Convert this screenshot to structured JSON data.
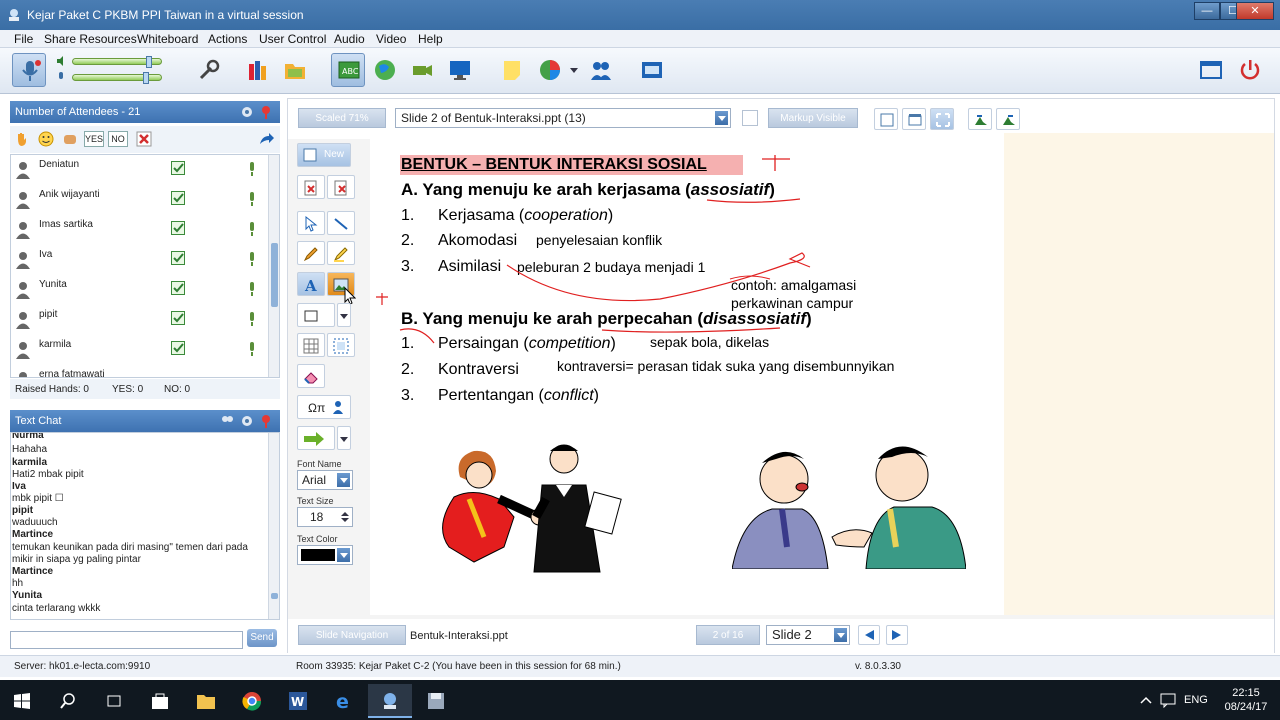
{
  "window": {
    "title": "Kejar Paket C PKBM PPI Taiwan in a virtual session",
    "controls": [
      "minimize",
      "maximize",
      "close"
    ]
  },
  "menu": [
    "File",
    "Share Resources",
    "Whiteboard",
    "Actions",
    "User Control",
    "Audio",
    "Video",
    "Help"
  ],
  "audio": {
    "mic_level": 0.92,
    "speaker_level": 0.88
  },
  "attendees": {
    "header": "Number of Attendees - 21",
    "quick_buttons": {
      "yes": "YES",
      "no": "NO"
    },
    "list": [
      {
        "name": "Deniatun"
      },
      {
        "name": "Anik wijayanti"
      },
      {
        "name": "Imas sartika"
      },
      {
        "name": "Iva"
      },
      {
        "name": "Yunita"
      },
      {
        "name": "pipit"
      },
      {
        "name": "karmila"
      },
      {
        "name": "erna fatmawati"
      }
    ],
    "raised_hands": "Raised Hands: 0",
    "yes_count": "YES: 0",
    "no_count": "NO: 0"
  },
  "chat": {
    "header": "Text Chat",
    "messages": [
      {
        "user": "Nurma",
        "text": "Hahaha"
      },
      {
        "user": "karmila",
        "text": "Hati2 mbak pipit"
      },
      {
        "user": "Iva",
        "text": "mbk pipit ☐"
      },
      {
        "user": "pipit",
        "text": "waduuuch"
      },
      {
        "user": "Martince",
        "text": "temukan keunikan pada diri masing\" temen dari pada",
        "text2": "mikir in siapa yg paling pintar"
      },
      {
        "user": "Martince",
        "text": "hh"
      },
      {
        "user": "Yunita",
        "text": "cinta terlarang wkkk"
      }
    ],
    "input_value": "",
    "send_label": "Send"
  },
  "whiteboard": {
    "scale_label": "Scaled 71%",
    "slide_select": "Slide 2 of Bentuk-Interaksi.ppt (13)",
    "markup_label": "Markup Visible",
    "new_label": "New",
    "font_name_label": "Font Name",
    "font_name": "Arial",
    "text_size_label": "Text Size",
    "text_size": "18",
    "text_color_label": "Text Color",
    "text_color": "#000000",
    "symbols_label": "Ωπ"
  },
  "slide": {
    "title": "BENTUK – BENTUK INTERAKSI SOSIAL",
    "a_heading_prefix": "A. Yang menuju ke arah kerjasama (",
    "a_heading_em": "assosiatif",
    "a_heading_suffix": ")",
    "a_items": [
      {
        "num": "1.",
        "text": "Kerjasama  (",
        "em": "cooperation",
        "end": ")"
      },
      {
        "num": "2.",
        "text": "Akomodasi",
        "em": "",
        "end": ""
      },
      {
        "num": "3.",
        "text": "Asimilasi",
        "em": "",
        "end": ""
      }
    ],
    "b_heading_prefix": "B. Yang menuju ke arah perpecahan (",
    "b_heading_em": "disassosiatif",
    "b_heading_suffix": ")",
    "b_items": [
      {
        "num": "1.",
        "text": "Persaingan (",
        "em": "competition",
        "end": ")"
      },
      {
        "num": "2.",
        "text": "Kontraversi",
        "em": "",
        "end": ""
      },
      {
        "num": "3.",
        "text": "Pertentangan (",
        "em": "conflict",
        "end": ")"
      }
    ],
    "annotations": {
      "akomodasi": "penyelesaian konflik",
      "asimilasi": "peleburan 2 budaya menjadi 1",
      "contoh1": "contoh: amalgamasi",
      "contoh2": "perkawinan campur",
      "persaingan": "sepak bola, dikelas",
      "kontraversi": "kontraversi= perasan tidak suka yang disembunnyikan"
    }
  },
  "navigation": {
    "label": "Slide Navigation",
    "file": "Bentuk-Interaksi.ppt",
    "page_count": "2 of 16",
    "slide_select": "Slide 2"
  },
  "status": {
    "server": "Server: hk01.e-lecta.com:9910",
    "room": "Room 33935: Kejar Paket C-2 (You have been in this session for 68 min.)",
    "version": "v. 8.0.3.30"
  },
  "taskbar": {
    "lang": "ENG",
    "time": "22:15",
    "date": "08/24/17"
  },
  "colors": {
    "accent": "#3e72b1",
    "annotation": "#e02020",
    "title_highlight": "#f5b0b0"
  }
}
